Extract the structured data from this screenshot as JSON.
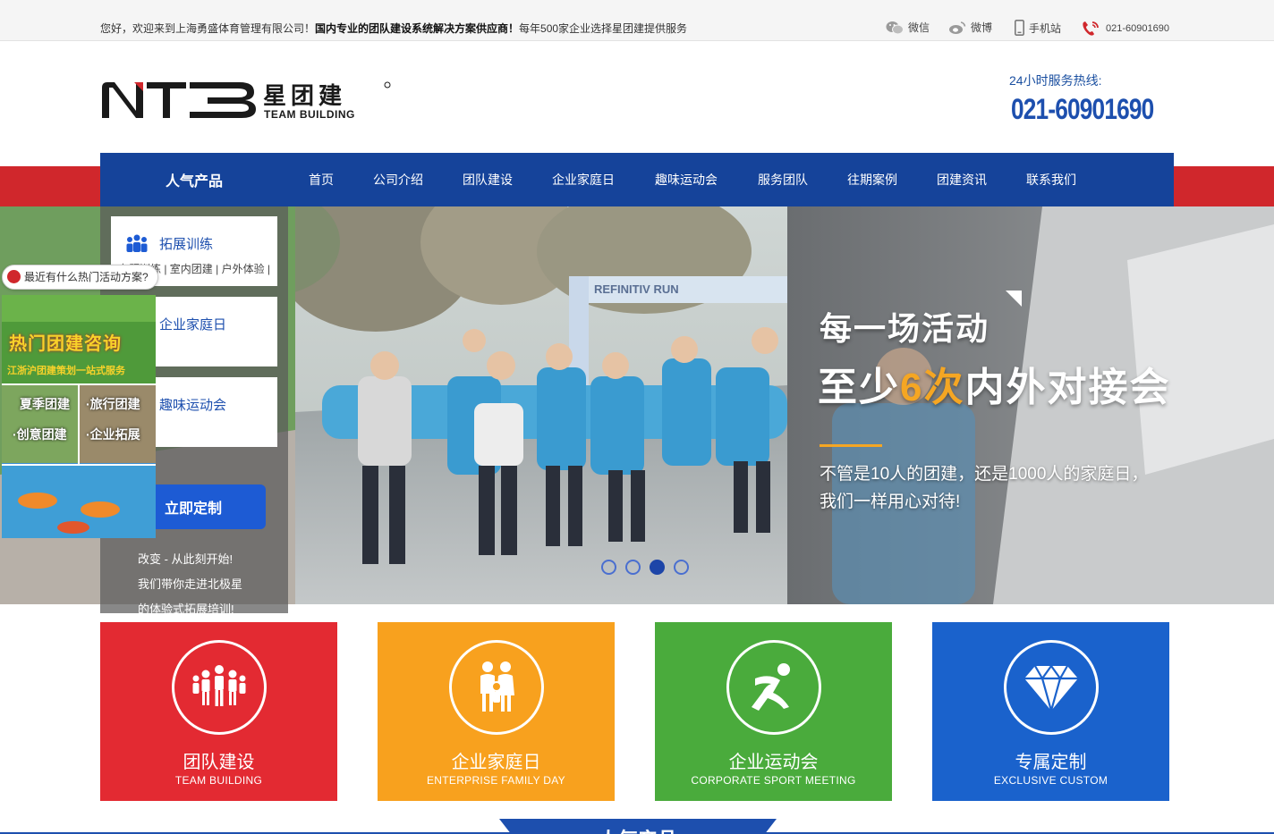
{
  "topbar": {
    "welcome_prefix": "您好，欢迎来到上海勇盛体育管理有限公司！",
    "welcome_bold": "国内专业的团队建设系统解决方案供应商！",
    "welcome_suffix": "每年500家企业选择星团建提供服务",
    "links": {
      "wechat": "微信",
      "weibo": "微博",
      "mobile": "手机站",
      "phone": "021-60901690"
    }
  },
  "header": {
    "logo_cn": "星团建",
    "logo_en": "TEAM BUILDING",
    "hotline_label": "24小时服务热线:",
    "hotline_number": "021-60901690"
  },
  "nav": {
    "category_label": "人气产品",
    "items": [
      "首页",
      "公司介绍",
      "团队建设",
      "企业家庭日",
      "趣味运动会",
      "服务团队",
      "往期案例",
      "团建资讯",
      "联系我们"
    ]
  },
  "sidebar": {
    "boxes": [
      {
        "title": "拓展训练",
        "sub": "专题训练 | 室内团建 | 户外体验 |"
      },
      {
        "title": "企业家庭日"
      },
      {
        "title": "趣味运动会"
      }
    ],
    "custom_button": "立即定制",
    "text_lines": [
      "改变 - 从此刻开始!",
      "我们带你走进北极星",
      "的体验式拓展培训!"
    ]
  },
  "float_ad": {
    "bubble": "最近有什么热门活动方案?",
    "title": "热门团建咨询",
    "subtitle": "江浙沪团建策划一站式服务",
    "cells": [
      "夏季团建",
      "·旅行团建",
      "·创意团建",
      "·企业拓展"
    ]
  },
  "banner": {
    "slogan_line1": "每一场活动",
    "slogan_line2_prefix": "至少",
    "slogan_line2_highlight": "6次",
    "slogan_line2_suffix": "内外对接会",
    "slogan_line3": "不管是10人的团建，还是1000人的家庭日，",
    "slogan_line4": "我们一样用心对待!",
    "arch_text": "REFINITIV RUN",
    "slides_count": 4,
    "active_slide": 3
  },
  "cards": [
    {
      "title": "团队建设",
      "sub": "TEAM BUILDING",
      "color": "#e32a32",
      "icon": "team-icon"
    },
    {
      "title": "企业家庭日",
      "sub": "ENTERPRISE FAMILY DAY",
      "color": "#f8a11e",
      "icon": "family-icon"
    },
    {
      "title": "企业运动会",
      "sub": "CORPORATE SPORT MEETING",
      "color": "#4aab3c",
      "icon": "runner-icon"
    },
    {
      "title": "专属定制",
      "sub": "EXCLUSIVE CUSTOM",
      "color": "#1a62cc",
      "icon": "diamond-icon"
    }
  ],
  "section": {
    "heading": "人气产品"
  }
}
